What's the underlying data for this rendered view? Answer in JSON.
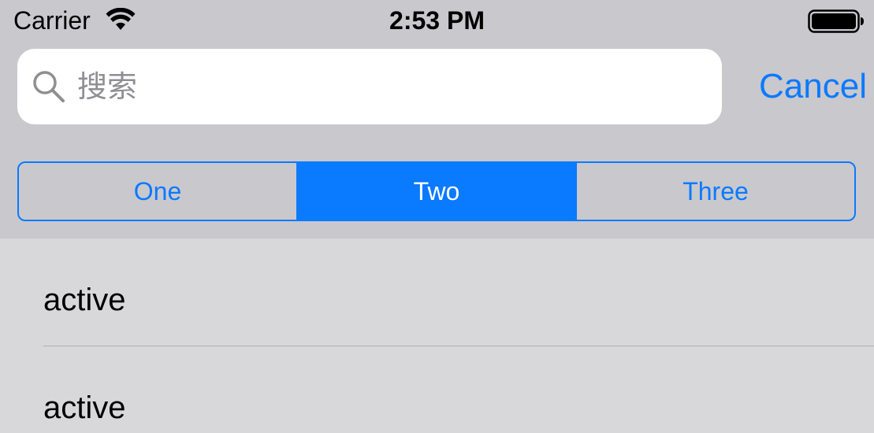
{
  "status_bar": {
    "carrier": "Carrier",
    "time": "2:53 PM",
    "wifi_icon": "wifi-icon",
    "battery_icon": "battery-icon"
  },
  "search": {
    "placeholder": "搜索",
    "value": "",
    "icon": "search-icon",
    "cancel_label": "Cancel"
  },
  "segmented_control": {
    "segments": [
      {
        "label": "One",
        "selected": false
      },
      {
        "label": "Two",
        "selected": true
      },
      {
        "label": "Three",
        "selected": false
      }
    ]
  },
  "list": {
    "rows": [
      {
        "label": "active"
      },
      {
        "label": "active"
      }
    ]
  },
  "colors": {
    "accent": "#0a7aff",
    "header_background": "#c9c8cd",
    "list_background": "#d8d8da"
  }
}
